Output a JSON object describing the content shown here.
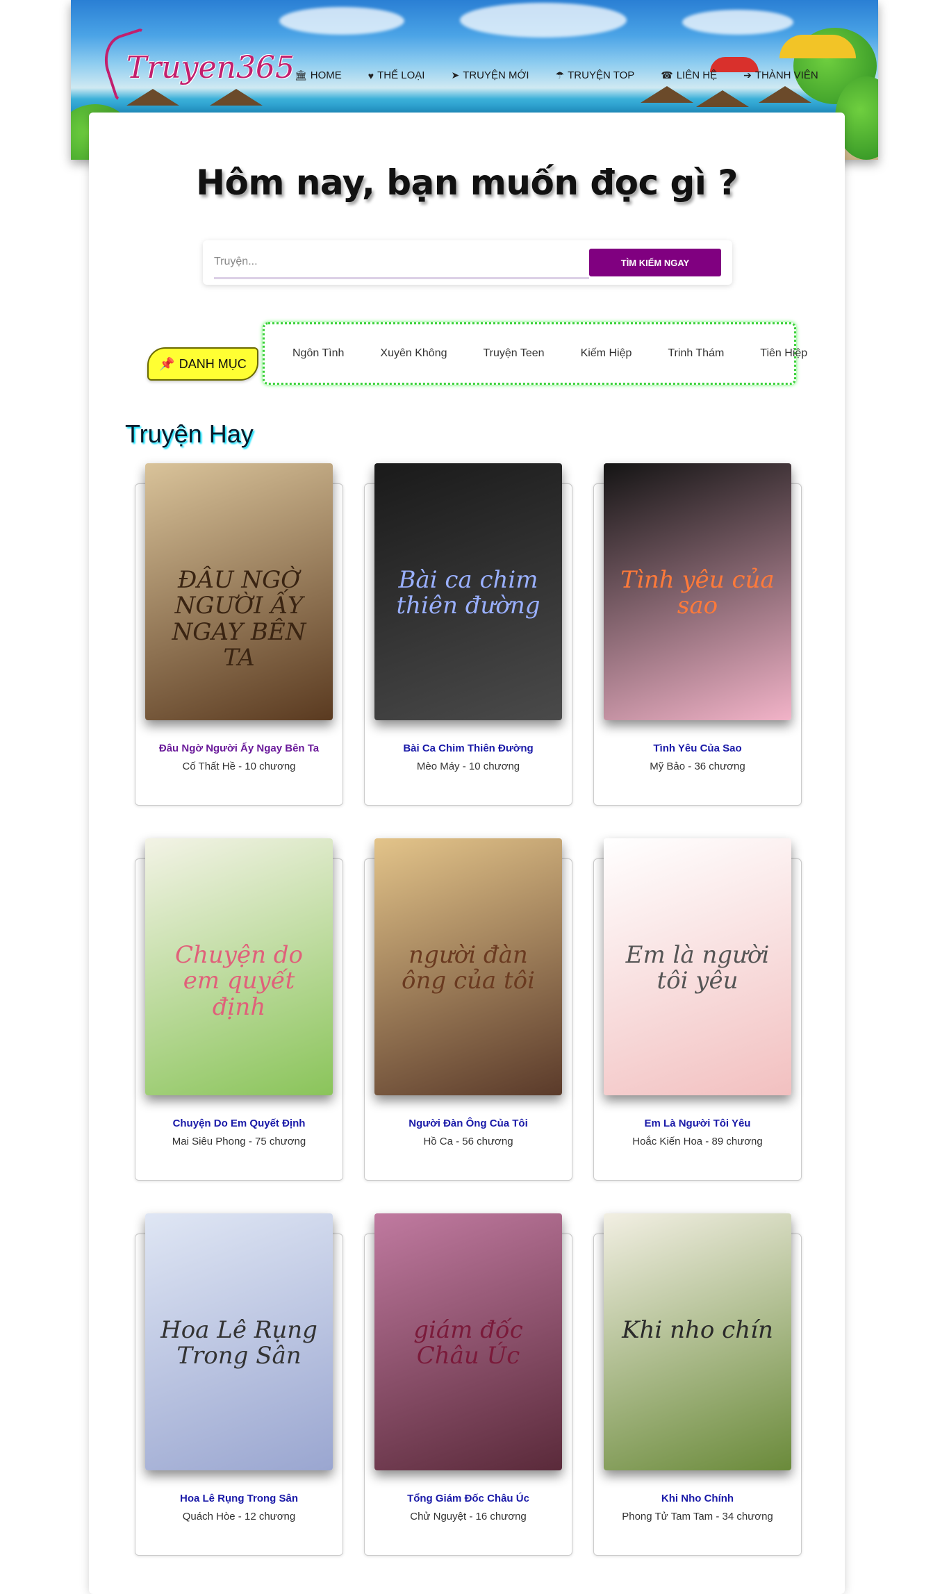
{
  "header": {
    "logo_text": "Truyen365",
    "nav": [
      {
        "icon": "🏛",
        "label": "HOME"
      },
      {
        "icon": "♥",
        "label": "THỂ LOẠI"
      },
      {
        "icon": "➤",
        "label": "TRUYỆN MỚI"
      },
      {
        "icon": "☂",
        "label": "TRUYỆN TOP"
      },
      {
        "icon": "☎",
        "label": "LIÊN HỆ"
      },
      {
        "icon": "➔",
        "label": "THÀNH VIÊN"
      }
    ]
  },
  "hero": {
    "headline": "Hôm nay, bạn muốn đọc gì ?",
    "search_placeholder": "Truyện...",
    "search_button": "TÌM KIẾM NGAY"
  },
  "categories": {
    "badge_icon": "📌",
    "badge_label": "DANH MỤC",
    "items": [
      "Ngôn Tình",
      "Xuyên Không",
      "Truyện Teen",
      "Kiếm Hiệp",
      "Trinh Thám",
      "Tiên Hiệp"
    ]
  },
  "section_title": "Truyện Hay",
  "books": [
    {
      "title": "Đâu Ngờ Người Ấy Ngay Bên Ta",
      "meta": "Cố Thất Hề - 10 chương",
      "cover_text": "ĐÂU NGỜ NGƯỜI ẤY NGAY BÊN TA",
      "bg1": "#d9c39a",
      "bg2": "#5a3a20",
      "ink": "#3a2412"
    },
    {
      "title": "Bài Ca Chim Thiên Đường",
      "meta": "Mèo Máy - 10 chương",
      "cover_text": "Bài ca chim thiên đường",
      "bg1": "#1a1a1a",
      "bg2": "#4a4a4a",
      "ink": "#9ab0ff"
    },
    {
      "title": "Tình Yêu Của Sao",
      "meta": "Mỹ Bảo - 36 chương",
      "cover_text": "Tình yêu của sao",
      "bg1": "#141414",
      "bg2": "#f2b3c8",
      "ink": "#ff7a3a"
    },
    {
      "title": "Chuyện Do Em Quyết Định",
      "meta": "Mai Siêu Phong - 75 chương",
      "cover_text": "Chuyện do em quyết định",
      "bg1": "#f3f3e6",
      "bg2": "#8ac45a",
      "ink": "#e0607a"
    },
    {
      "title": "Người Đàn Ông Của Tôi",
      "meta": "Hồ Ca - 56 chương",
      "cover_text": "người đàn ông của tôi",
      "bg1": "#e3c48a",
      "bg2": "#5a3a2a",
      "ink": "#6a3a20"
    },
    {
      "title": "Em Là Người Tôi Yêu",
      "meta": "Hoắc Kiến Hoa - 89 chương",
      "cover_text": "Em là người tôi yêu",
      "bg1": "#ffffff",
      "bg2": "#f2c0c0",
      "ink": "#555555"
    },
    {
      "title": "Hoa Lê Rụng Trong Sân",
      "meta": "Quách Hòe - 12 chương",
      "cover_text": "Hoa Lê Rụng Trong Sân",
      "bg1": "#dfe6f4",
      "bg2": "#9aa6d0",
      "ink": "#333333"
    },
    {
      "title": "Tổng Giám Đốc Châu Úc",
      "meta": "Chử Nguyệt - 16 chương",
      "cover_text": "giám đốc Châu Úc",
      "bg1": "#c07aa0",
      "bg2": "#5a2a3a",
      "ink": "#7a1a3a"
    },
    {
      "title": "Khi Nho Chính",
      "meta": "Phong Tử Tam Tam - 34 chương",
      "cover_text": "Khi nho chín",
      "bg1": "#f2efe3",
      "bg2": "#6a8a3a",
      "ink": "#2a2a2a"
    }
  ]
}
